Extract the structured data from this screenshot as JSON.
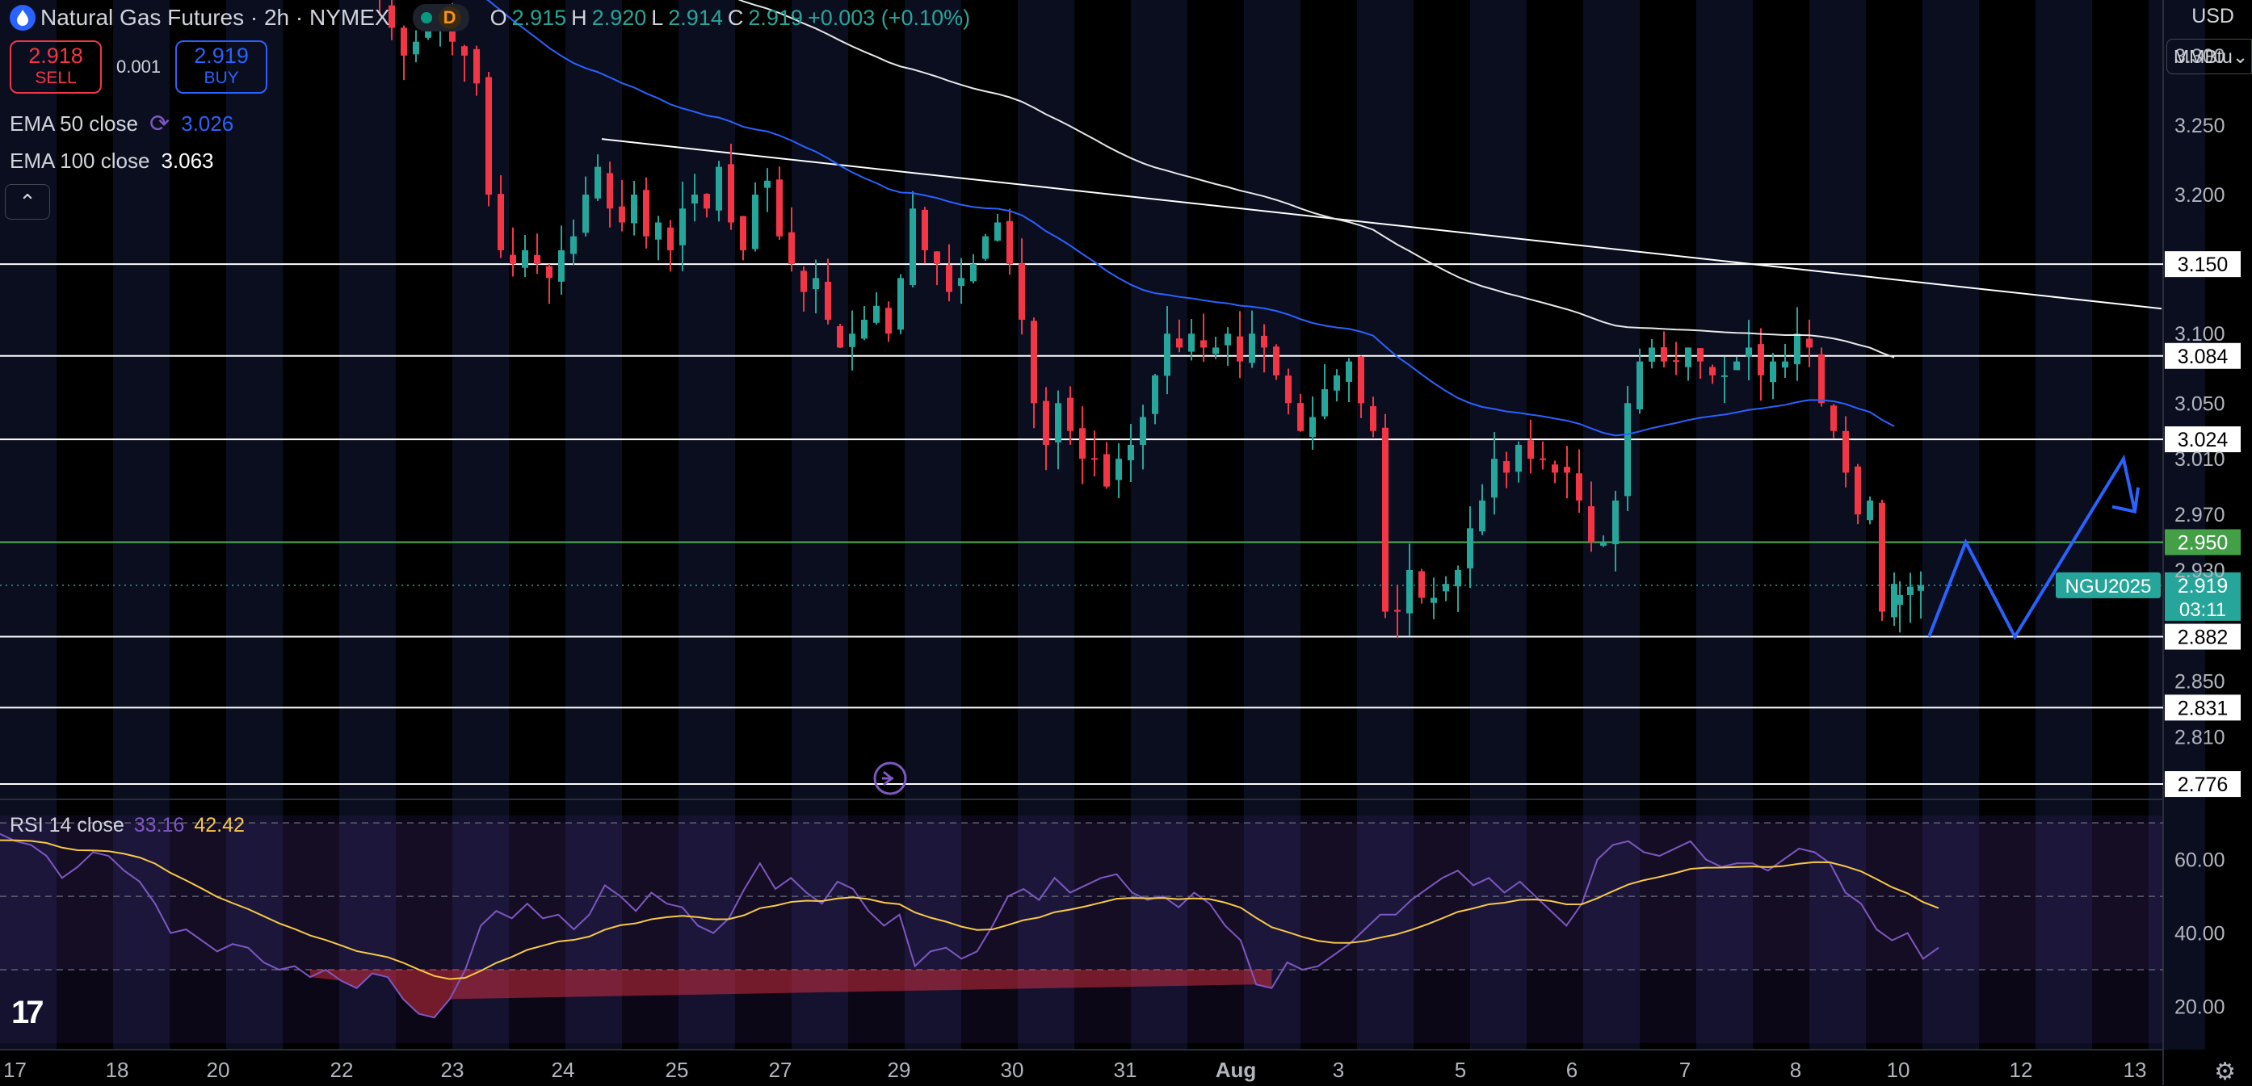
{
  "header": {
    "title": "Natural Gas Futures · 2h · NYMEX",
    "session_badge": "D",
    "open_label": "O",
    "open": "2.915",
    "high_label": "H",
    "high": "2.920",
    "low_label": "L",
    "low": "2.914",
    "close_label": "C",
    "close": "2.919",
    "change": "+0.003 (+0.10%)"
  },
  "trade": {
    "sell_price": "2.918",
    "sell_label": "SELL",
    "spread": "0.001",
    "buy_price": "2.919",
    "buy_label": "BUY"
  },
  "indicators": {
    "ema50_label": "EMA 50 close",
    "ema50_value": "3.026",
    "ema100_label": "EMA 100 close",
    "ema100_value": "3.063",
    "rsi_label": "RSI 14 close",
    "rsi_value": "33.16",
    "rsi_ma_value": "42.42"
  },
  "price_axis": {
    "currency": "USD",
    "unit": "MMBtu",
    "ticks": [
      "3.300",
      "3.250",
      "3.200",
      "3.100",
      "3.050",
      "3.010",
      "2.970",
      "2.930",
      "2.850",
      "2.810"
    ],
    "current_symbol": "NGU2025",
    "current_price": "2.919",
    "countdown": "03:11"
  },
  "rsi_axis": {
    "ticks": [
      "60.00",
      "40.00",
      "20.00"
    ]
  },
  "time_axis": {
    "labels": [
      "17",
      "18",
      "20",
      "22",
      "23",
      "24",
      "25",
      "27",
      "29",
      "30",
      "31",
      "Aug",
      "3",
      "5",
      "6",
      "7",
      "8",
      "10",
      "12",
      "13"
    ]
  },
  "colors": {
    "up": "#26a69a",
    "down": "#f23645",
    "ema50": "#2962ff",
    "ema100": "#e8e8e8",
    "rsi": "#7e57c2",
    "rsi_ma": "#f7c948",
    "projection": "#2962ff",
    "level_green": "#4caf50"
  },
  "chart_data": {
    "type": "candlestick",
    "ylim": [
      2.765,
      3.34
    ],
    "horizontal_levels": [
      {
        "value": 3.15,
        "label": "3.150",
        "color": "#ffffff"
      },
      {
        "value": 3.084,
        "label": "3.084",
        "color": "#ffffff"
      },
      {
        "value": 3.024,
        "label": "3.024",
        "color": "#ffffff"
      },
      {
        "value": 2.95,
        "label": "2.950",
        "color": "#4caf50"
      },
      {
        "value": 2.882,
        "label": "2.882",
        "color": "#ffffff"
      },
      {
        "value": 2.831,
        "label": "2.831",
        "color": "#ffffff"
      },
      {
        "value": 2.776,
        "label": "2.776",
        "color": "#ffffff"
      }
    ],
    "trendline": [
      {
        "t": 24.3,
        "v": 3.24
      },
      {
        "t": 13.2,
        "v": 3.118
      }
    ],
    "closes": [
      3.34,
      3.32,
      3.3,
      3.31,
      3.32,
      3.33,
      3.31,
      3.3,
      3.28,
      3.2,
      3.16,
      3.15,
      3.16,
      3.15,
      3.14,
      3.16,
      3.17,
      3.2,
      3.22,
      3.19,
      3.18,
      3.2,
      3.17,
      3.18,
      3.16,
      3.19,
      3.2,
      3.19,
      3.22,
      3.18,
      3.16,
      3.2,
      3.21,
      3.17,
      3.15,
      3.13,
      3.14,
      3.11,
      3.09,
      3.1,
      3.11,
      3.12,
      3.1,
      3.14,
      3.19,
      3.16,
      3.15,
      3.13,
      3.14,
      3.15,
      3.17,
      3.18,
      3.15,
      3.11,
      3.05,
      3.02,
      3.05,
      3.03,
      3.01,
      3.01,
      2.99,
      3.01,
      3.02,
      3.04,
      3.07,
      3.1,
      3.09,
      3.1,
      3.09,
      3.09,
      3.1,
      3.08,
      3.1,
      3.09,
      3.07,
      3.05,
      3.03,
      3.04,
      3.06,
      3.07,
      3.08,
      3.05,
      3.03,
      2.9,
      2.9,
      2.93,
      2.91,
      2.91,
      2.92,
      2.93,
      2.96,
      2.98,
      3.01,
      3.0,
      3.02,
      3.01,
      3.01,
      3.0,
      3.0,
      2.98,
      2.95,
      2.95,
      2.98,
      3.05,
      3.08,
      3.09,
      3.08,
      3.08,
      3.09,
      3.08,
      3.07,
      3.07,
      3.08,
      3.09,
      3.07,
      3.08,
      3.08,
      3.1,
      3.09,
      3.05,
      3.03,
      3.0,
      2.97,
      2.98,
      2.9,
      2.92
    ],
    "ema50_label_value": 3.026,
    "ema100_label_value": 3.063,
    "projection_path": [
      {
        "t": 10.5,
        "v": 2.882
      },
      {
        "t": 11.1,
        "v": 2.95
      },
      {
        "t": 11.9,
        "v": 2.882
      },
      {
        "t": 12.9,
        "v": 3.01
      },
      {
        "t": 13.4,
        "v": 2.972
      }
    ],
    "rsi": {
      "ylim": [
        10,
        72
      ],
      "bands": [
        70,
        50,
        30
      ],
      "values": [
        67,
        65,
        64,
        61,
        55,
        58,
        62,
        61,
        57,
        54,
        48,
        40,
        41,
        38,
        35,
        37,
        36,
        32,
        30,
        31,
        28,
        30,
        27,
        25,
        29,
        28,
        22,
        18,
        17,
        22,
        30,
        42,
        46,
        44,
        48,
        44,
        45,
        41,
        45,
        53,
        50,
        46,
        51,
        48,
        47,
        42,
        40,
        44,
        52,
        59,
        52,
        55,
        51,
        48,
        54,
        52,
        46,
        42,
        45,
        31,
        35,
        36,
        33,
        35,
        42,
        50,
        52,
        49,
        55,
        51,
        53,
        55,
        56,
        51,
        49,
        50,
        47,
        51,
        48,
        42,
        38,
        26,
        25,
        32,
        30,
        31,
        34,
        37,
        41,
        45,
        45,
        49,
        52,
        55,
        57,
        53,
        55,
        51,
        54,
        50,
        46,
        42,
        48,
        60,
        64,
        65,
        62,
        61,
        63,
        65,
        60,
        58,
        59,
        59,
        57,
        60,
        63,
        62,
        59,
        51,
        48,
        41,
        38,
        40,
        33,
        36
      ],
      "ma_start": 65,
      "ma_end": 42.42
    }
  }
}
